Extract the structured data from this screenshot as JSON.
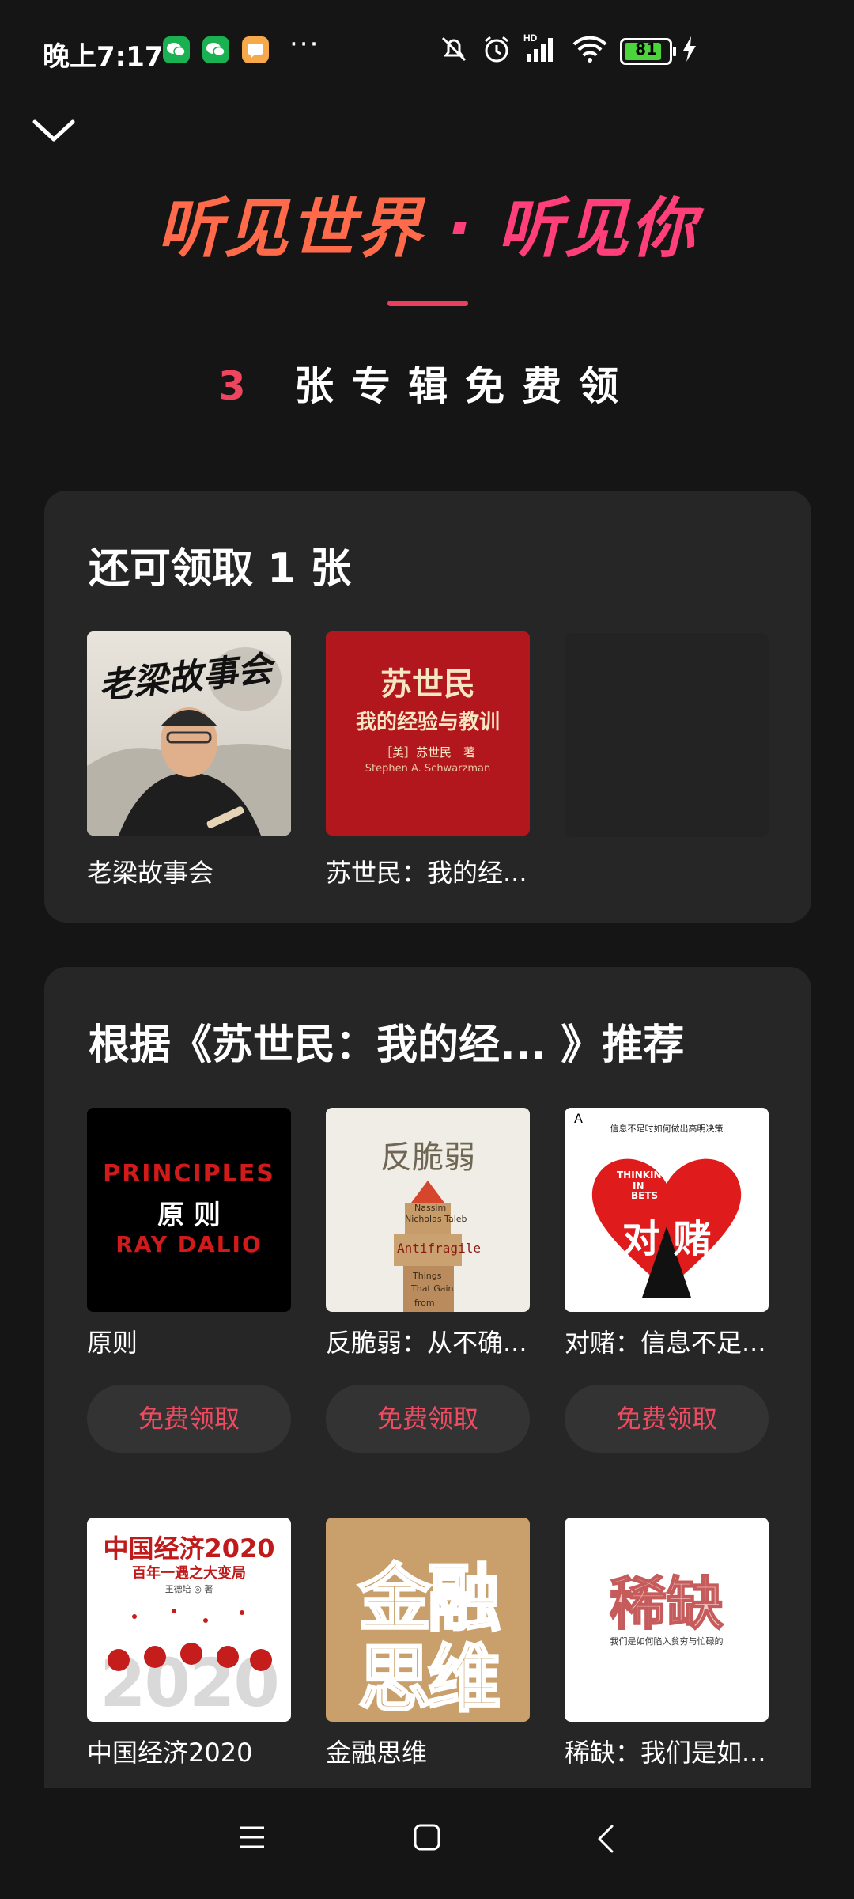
{
  "status": {
    "time": "晚上7:17",
    "more": "···",
    "battery": "81",
    "icons": [
      "wechat-icon",
      "wechat-icon",
      "message-icon",
      "mute-icon",
      "alarm-icon",
      "signal-icon",
      "wifi-icon",
      "battery-icon",
      "charging-icon"
    ]
  },
  "hero": {
    "title_a": "听见世界",
    "dot": "·",
    "title_b": "听见你",
    "sub_num": "3",
    "sub_text": "张专辑免费领"
  },
  "claimable": {
    "title": "还可领取 1 张",
    "items": [
      {
        "label": "老梁故事会",
        "cover_text": "老梁故事会"
      },
      {
        "label": "苏世民：我的经...",
        "cover_title": "苏世民",
        "cover_sub": "我的经验与教训",
        "cover_author": "［美］苏世民　著",
        "cover_en": "Stephen A. Schwarzman"
      }
    ]
  },
  "recommend": {
    "title": "根据《苏世民：我的经... 》推荐",
    "claim_label": "免费领取",
    "items": [
      {
        "label": "原则",
        "cover_lines": [
          "PRINCIPLES",
          "原 则",
          "RAY DALIO"
        ]
      },
      {
        "label": "反脆弱：从不确...",
        "cover_title": "反脆弱",
        "cover_lines": [
          "Nassim",
          "Nicholas Taleb",
          "Antifragile",
          "Things",
          "That Gain",
          "from"
        ]
      },
      {
        "label": "对赌：信息不足...",
        "cover_top": "信息不足时如何做出高明决策",
        "cover_lines": [
          "THINKING",
          "IN",
          "BETS",
          "对 赌"
        ],
        "cover_card": "A"
      },
      {
        "label": "中国经济2020",
        "cover_title": "中国经济2020",
        "cover_sub": "百年一遇之大变局",
        "cover_author": "王德培 ◎ 著",
        "cover_big": "2020"
      },
      {
        "label": "金融思维",
        "cover_lines": [
          "金融",
          "思维"
        ]
      },
      {
        "label": "稀缺：我们是如...",
        "cover_title": "稀缺",
        "cover_sub": "我们是如何陷入贫穷与忙碌的"
      }
    ]
  },
  "colors": {
    "background": "#151515",
    "card": "#262626",
    "accent": "#ee4a60",
    "button": "#333333"
  }
}
